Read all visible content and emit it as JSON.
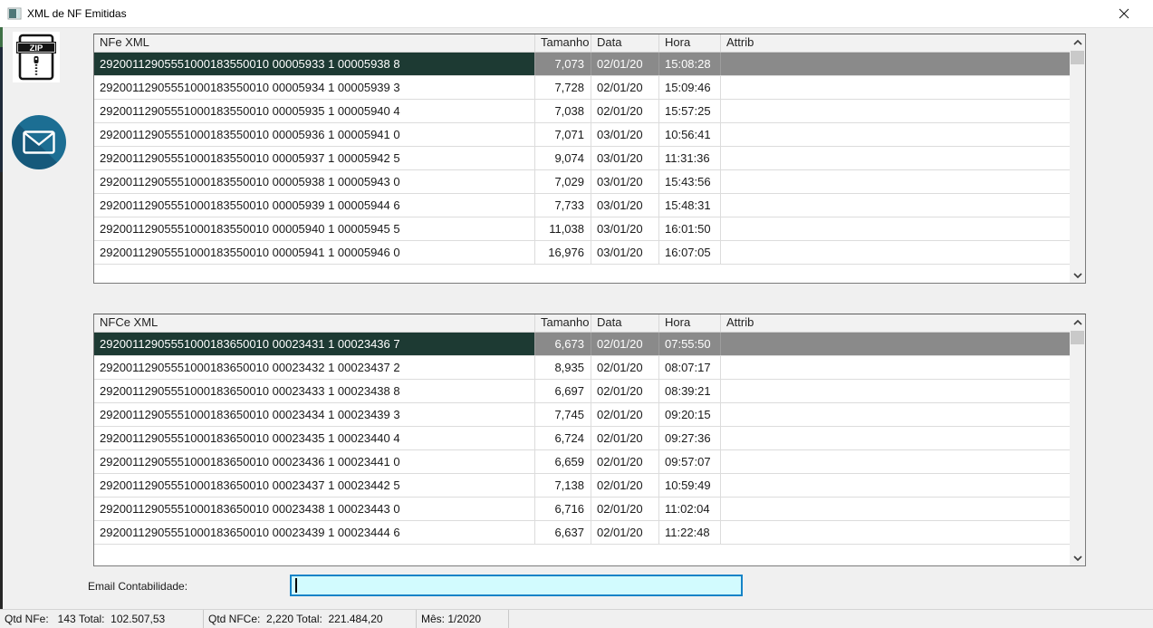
{
  "window": {
    "title": "XML de NF Emitidas"
  },
  "toolbar": {
    "zip_label": "ZIP",
    "zip_button": "export-zip",
    "mail_button": "send-email"
  },
  "tables": {
    "nfe": {
      "columns": [
        "NFe XML",
        "Tamanho",
        "Data",
        "Hora",
        "Attrib"
      ],
      "selected_index": 0,
      "rows": [
        [
          "29200112905551000183550010 00005933 1 00005938 8",
          "7,073",
          "02/01/20",
          "15:08:28",
          ""
        ],
        [
          "29200112905551000183550010 00005934 1 00005939 3",
          "7,728",
          "02/01/20",
          "15:09:46",
          ""
        ],
        [
          "29200112905551000183550010 00005935 1 00005940 4",
          "7,038",
          "02/01/20",
          "15:57:25",
          ""
        ],
        [
          "29200112905551000183550010 00005936 1 00005941 0",
          "7,071",
          "03/01/20",
          "10:56:41",
          ""
        ],
        [
          "29200112905551000183550010 00005937 1 00005942 5",
          "9,074",
          "03/01/20",
          "11:31:36",
          ""
        ],
        [
          "29200112905551000183550010 00005938 1 00005943 0",
          "7,029",
          "03/01/20",
          "15:43:56",
          ""
        ],
        [
          "29200112905551000183550010 00005939 1 00005944 6",
          "7,733",
          "03/01/20",
          "15:48:31",
          ""
        ],
        [
          "29200112905551000183550010 00005940 1 00005945 5",
          "11,038",
          "03/01/20",
          "16:01:50",
          ""
        ],
        [
          "29200112905551000183550010 00005941 1 00005946 0",
          "16,976",
          "03/01/20",
          "16:07:05",
          ""
        ]
      ]
    },
    "nfce": {
      "columns": [
        "NFCe XML",
        "Tamanho",
        "Data",
        "Hora",
        "Attrib"
      ],
      "selected_index": 0,
      "rows": [
        [
          "29200112905551000183650010 00023431 1 00023436 7",
          "6,673",
          "02/01/20",
          "07:55:50",
          ""
        ],
        [
          "29200112905551000183650010 00023432 1 00023437 2",
          "8,935",
          "02/01/20",
          "08:07:17",
          ""
        ],
        [
          "29200112905551000183650010 00023433 1 00023438 8",
          "6,697",
          "02/01/20",
          "08:39:21",
          ""
        ],
        [
          "29200112905551000183650010 00023434 1 00023439 3",
          "7,745",
          "02/01/20",
          "09:20:15",
          ""
        ],
        [
          "29200112905551000183650010 00023435 1 00023440 4",
          "6,724",
          "02/01/20",
          "09:27:36",
          ""
        ],
        [
          "29200112905551000183650010 00023436 1 00023441 0",
          "6,659",
          "02/01/20",
          "09:57:07",
          ""
        ],
        [
          "29200112905551000183650010 00023437 1 00023442 5",
          "7,138",
          "02/01/20",
          "10:59:49",
          ""
        ],
        [
          "29200112905551000183650010 00023438 1 00023443 0",
          "6,716",
          "02/01/20",
          "11:02:04",
          ""
        ],
        [
          "29200112905551000183650010 00023439 1 00023444 6",
          "6,637",
          "02/01/20",
          "11:22:48",
          ""
        ]
      ]
    }
  },
  "email": {
    "label": "Email Contabilidade:",
    "value": ""
  },
  "statusbar": {
    "panels": [
      "Qtd NFe:   143 Total:  102.507,53",
      "Qtd NFCe:  2,220 Total:  221.484,20",
      "Mês: 1/2020",
      ""
    ]
  },
  "colors": {
    "selection_primary": "#1d3a33",
    "selection_secondary": "#8a8a8a",
    "email_input_bg": "#d2fbfe",
    "email_input_border": "#1583c7",
    "mail_icon_bg": "#1c6e93"
  }
}
